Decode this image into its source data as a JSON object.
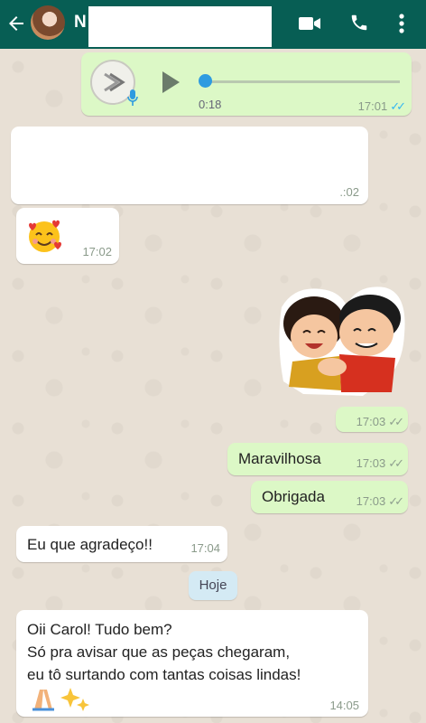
{
  "header": {
    "contact_initial": "N",
    "icons": [
      "back-arrow-icon",
      "video-call-icon",
      "phone-icon",
      "more-options-icon"
    ],
    "colors": {
      "bar": "#075e54",
      "outgoing_bubble": "#dcf8c6",
      "incoming_bubble": "#ffffff",
      "read_ticks": "#34b7f1"
    }
  },
  "voice_message": {
    "duration": "0:18",
    "time": "17:01",
    "status": "read",
    "progress": 0.0
  },
  "messages": [
    {
      "direction": "incoming",
      "text": "",
      "time": "17:02"
    },
    {
      "direction": "incoming",
      "text": "🥰",
      "time": "17:02"
    },
    {
      "direction": "outgoing",
      "type": "sticker",
      "time": "17:03",
      "status": "delivered"
    },
    {
      "direction": "outgoing",
      "text": "Maravilhosa",
      "time": "17:03",
      "status": "delivered"
    },
    {
      "direction": "outgoing",
      "text": "Obrigada",
      "time": "17:03",
      "status": "delivered"
    },
    {
      "direction": "incoming",
      "text": "Eu que agradeço!!",
      "time": "17:04"
    },
    {
      "direction": "incoming",
      "lines": [
        "Oii Carol! Tudo bem?",
        "Só pra avisar que as peças chegaram,",
        "eu tô surtando com tantas coisas lindas!"
      ],
      "emojis": "🙏✨",
      "time": "14:05"
    }
  ],
  "date_divider": "Hoje",
  "tick_glyph": "✓✓",
  "partial_time_visible": ".:02"
}
